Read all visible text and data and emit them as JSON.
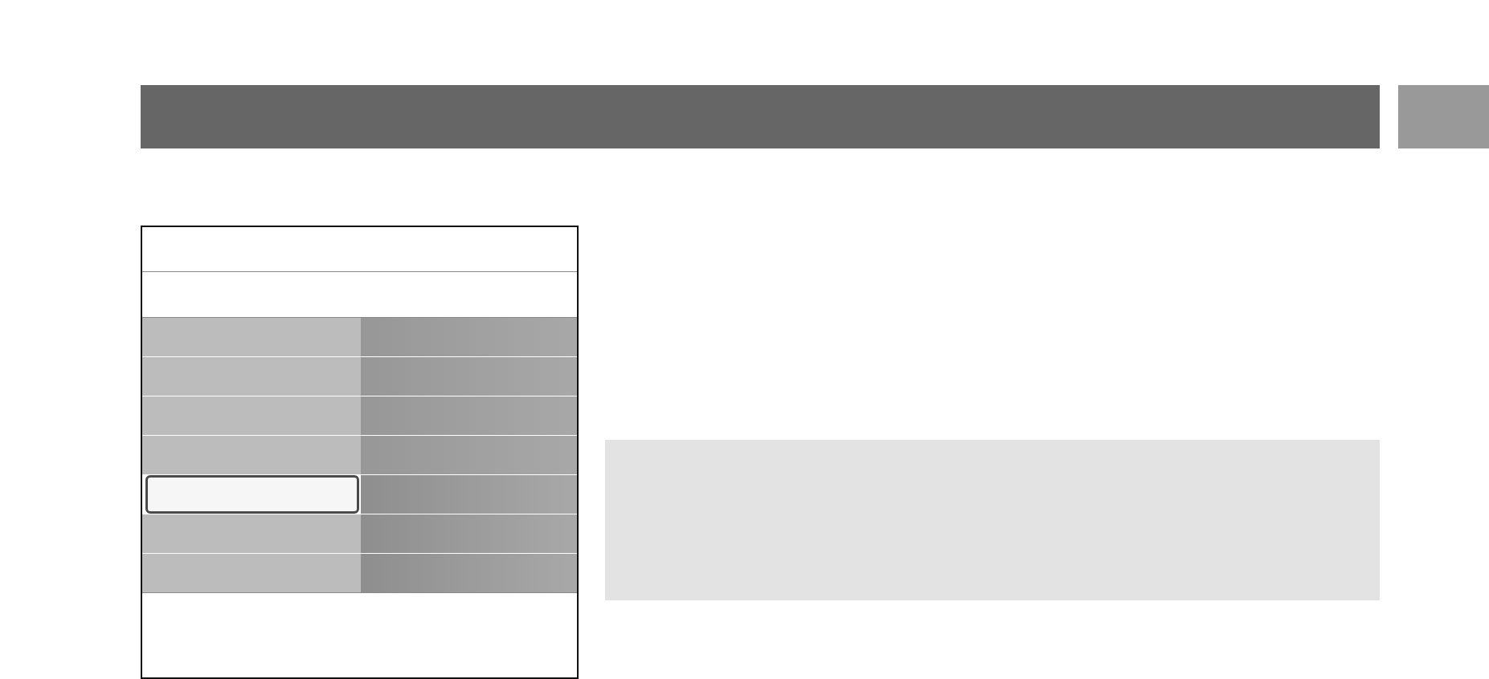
{
  "menu": {
    "items": [
      {
        "selected": false
      },
      {
        "selected": false
      },
      {
        "selected": false
      },
      {
        "selected": false
      },
      {
        "selected": true
      },
      {
        "selected": false
      },
      {
        "selected": false
      }
    ]
  }
}
